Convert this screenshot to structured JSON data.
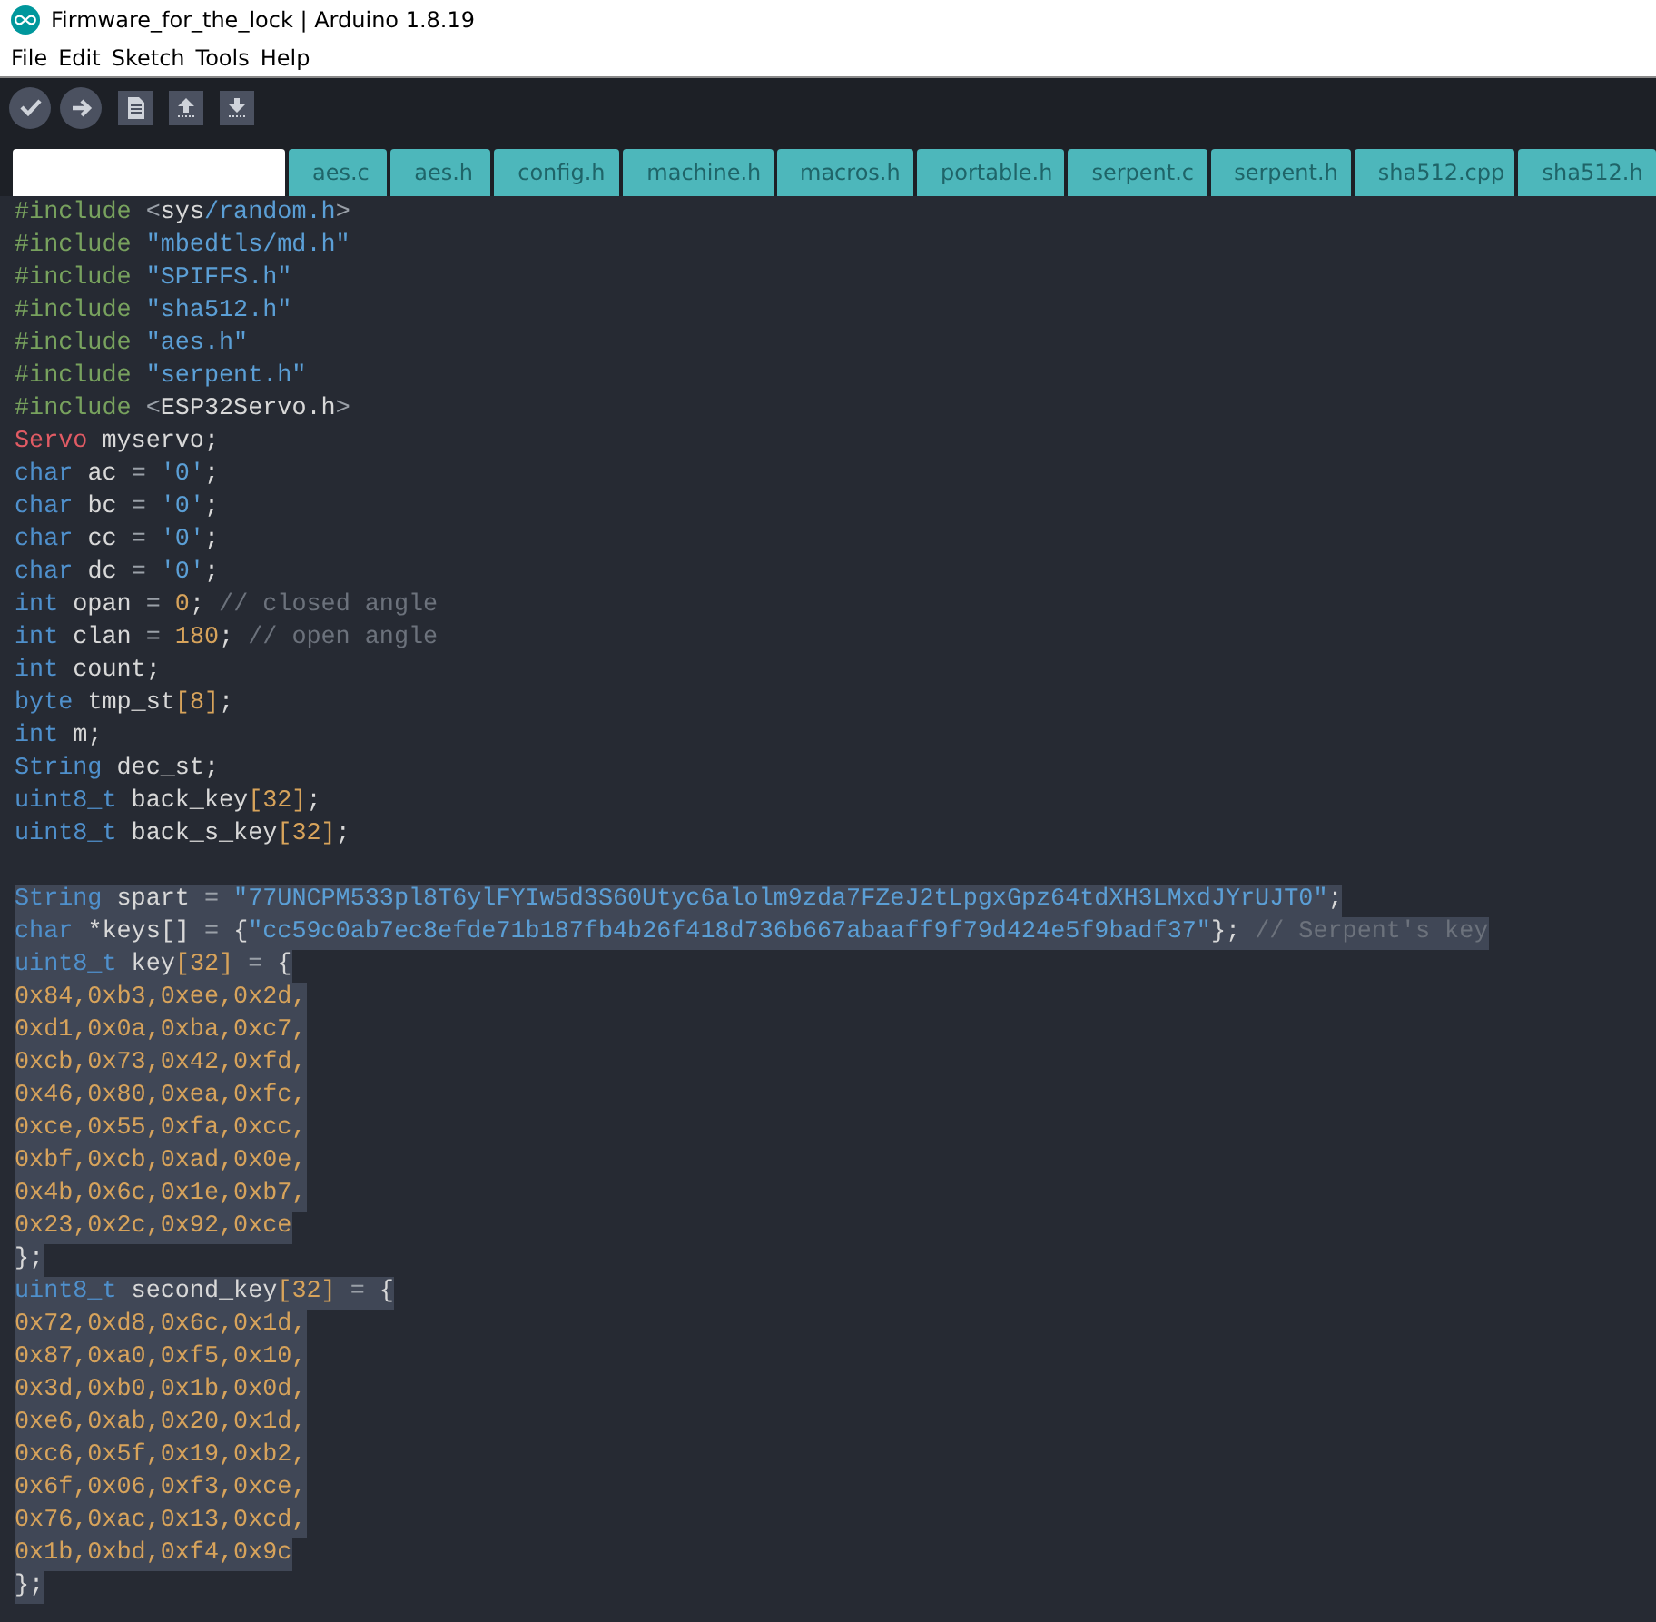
{
  "window": {
    "title": "Firmware_for_the_lock | Arduino 1.8.19"
  },
  "menu": [
    "File",
    "Edit",
    "Sketch",
    "Tools",
    "Help"
  ],
  "toolbar": [
    {
      "kind": "verify"
    },
    {
      "kind": "upload"
    },
    {
      "kind": "new"
    },
    {
      "kind": "open"
    },
    {
      "kind": "save"
    }
  ],
  "tabs": [
    {
      "selected": true
    },
    {
      "label": "aes.c",
      "selected": false
    },
    {
      "label": "aes.h",
      "selected": false
    },
    {
      "label": "config.h",
      "selected": false
    },
    {
      "label": "machine.h",
      "selected": false
    },
    {
      "label": "macros.h",
      "selected": false
    },
    {
      "label": "portable.h",
      "selected": false
    },
    {
      "label": "serpent.c",
      "selected": false
    },
    {
      "label": "serpent.h",
      "selected": false
    },
    {
      "label": "sha512.cpp",
      "selected": false
    },
    {
      "label": "sha512.h",
      "selected": false
    }
  ],
  "code": [
    {
      "selected": false,
      "tokens": [
        {
          "kind": "pre",
          "text": "#include "
        },
        {
          "kind": "punct",
          "text": "<"
        },
        {
          "kind": "plain",
          "text": "sys"
        },
        {
          "kind": "str",
          "text": "/random.h"
        },
        {
          "kind": "punct",
          "text": ">"
        }
      ]
    },
    {
      "selected": false,
      "tokens": [
        {
          "kind": "pre",
          "text": "#include "
        },
        {
          "kind": "str",
          "text": "\"mbedtls/md.h\""
        }
      ]
    },
    {
      "selected": false,
      "tokens": [
        {
          "kind": "pre",
          "text": "#include "
        },
        {
          "kind": "str",
          "text": "\"SPIFFS.h\""
        }
      ]
    },
    {
      "selected": false,
      "tokens": [
        {
          "kind": "pre",
          "text": "#include "
        },
        {
          "kind": "str",
          "text": "\"sha512.h\""
        }
      ]
    },
    {
      "selected": false,
      "tokens": [
        {
          "kind": "pre",
          "text": "#include "
        },
        {
          "kind": "str",
          "text": "\"aes.h\""
        }
      ]
    },
    {
      "selected": false,
      "tokens": [
        {
          "kind": "pre",
          "text": "#include "
        },
        {
          "kind": "str",
          "text": "\"serpent.h\""
        }
      ]
    },
    {
      "selected": false,
      "tokens": [
        {
          "kind": "pre",
          "text": "#include "
        },
        {
          "kind": "punct",
          "text": "<"
        },
        {
          "kind": "plain",
          "text": "ESP32Servo.h"
        },
        {
          "kind": "punct",
          "text": ">"
        }
      ]
    },
    {
      "selected": false,
      "tokens": [
        {
          "kind": "class",
          "text": "Servo"
        },
        {
          "kind": "plain",
          "text": " myservo;"
        }
      ]
    },
    {
      "selected": false,
      "tokens": [
        {
          "kind": "type",
          "text": "char"
        },
        {
          "kind": "plain",
          "text": " ac "
        },
        {
          "kind": "punct",
          "text": "= "
        },
        {
          "kind": "str",
          "text": "'0'"
        },
        {
          "kind": "plain",
          "text": ";"
        }
      ]
    },
    {
      "selected": false,
      "tokens": [
        {
          "kind": "type",
          "text": "char"
        },
        {
          "kind": "plain",
          "text": " bc "
        },
        {
          "kind": "punct",
          "text": "= "
        },
        {
          "kind": "str",
          "text": "'0'"
        },
        {
          "kind": "plain",
          "text": ";"
        }
      ]
    },
    {
      "selected": false,
      "tokens": [
        {
          "kind": "type",
          "text": "char"
        },
        {
          "kind": "plain",
          "text": " cc "
        },
        {
          "kind": "punct",
          "text": "= "
        },
        {
          "kind": "str",
          "text": "'0'"
        },
        {
          "kind": "plain",
          "text": ";"
        }
      ]
    },
    {
      "selected": false,
      "tokens": [
        {
          "kind": "type",
          "text": "char"
        },
        {
          "kind": "plain",
          "text": " dc "
        },
        {
          "kind": "punct",
          "text": "= "
        },
        {
          "kind": "str",
          "text": "'0'"
        },
        {
          "kind": "plain",
          "text": ";"
        }
      ]
    },
    {
      "selected": false,
      "tokens": [
        {
          "kind": "type",
          "text": "int"
        },
        {
          "kind": "plain",
          "text": " opan "
        },
        {
          "kind": "punct",
          "text": "= "
        },
        {
          "kind": "num",
          "text": "0"
        },
        {
          "kind": "plain",
          "text": "; "
        },
        {
          "kind": "comment",
          "text": "// closed angle"
        }
      ]
    },
    {
      "selected": false,
      "tokens": [
        {
          "kind": "type",
          "text": "int"
        },
        {
          "kind": "plain",
          "text": " clan "
        },
        {
          "kind": "punct",
          "text": "= "
        },
        {
          "kind": "num",
          "text": "180"
        },
        {
          "kind": "plain",
          "text": "; "
        },
        {
          "kind": "comment",
          "text": "// open angle"
        }
      ]
    },
    {
      "selected": false,
      "tokens": [
        {
          "kind": "type",
          "text": "int"
        },
        {
          "kind": "plain",
          "text": " count;"
        }
      ]
    },
    {
      "selected": false,
      "tokens": [
        {
          "kind": "type",
          "text": "byte"
        },
        {
          "kind": "plain",
          "text": " tmp_st"
        },
        {
          "kind": "num",
          "text": "[8]"
        },
        {
          "kind": "plain",
          "text": ";"
        }
      ]
    },
    {
      "selected": false,
      "tokens": [
        {
          "kind": "type",
          "text": "int"
        },
        {
          "kind": "plain",
          "text": " m;"
        }
      ]
    },
    {
      "selected": false,
      "tokens": [
        {
          "kind": "type",
          "text": "String"
        },
        {
          "kind": "plain",
          "text": " dec_st;"
        }
      ]
    },
    {
      "selected": false,
      "tokens": [
        {
          "kind": "type",
          "text": "uint8_t"
        },
        {
          "kind": "plain",
          "text": " back_key"
        },
        {
          "kind": "num",
          "text": "[32]"
        },
        {
          "kind": "plain",
          "text": ";"
        }
      ]
    },
    {
      "selected": false,
      "tokens": [
        {
          "kind": "type",
          "text": "uint8_t"
        },
        {
          "kind": "plain",
          "text": " back_s_key"
        },
        {
          "kind": "num",
          "text": "[32]"
        },
        {
          "kind": "plain",
          "text": ";"
        }
      ]
    },
    {
      "kind": "blank"
    },
    {
      "selected": true,
      "tokens": [
        {
          "kind": "type",
          "text": "String"
        },
        {
          "kind": "plain",
          "text": " spart "
        },
        {
          "kind": "punct",
          "text": "= "
        },
        {
          "kind": "str",
          "text": "\"77UNCPM533pl8T6ylFYIw5d3S60Utyc6alolm9zda7FZeJ2tLpgxGpz64tdXH3LMxdJYrUJT0\""
        },
        {
          "kind": "plain",
          "text": ";"
        }
      ]
    },
    {
      "selected": true,
      "tokens": [
        {
          "kind": "type",
          "text": "char"
        },
        {
          "kind": "plain",
          "text": " *keys[] "
        },
        {
          "kind": "punct",
          "text": "="
        },
        {
          "kind": "plain",
          "text": " {"
        },
        {
          "kind": "str",
          "text": "\"cc59c0ab7ec8efde71b187fb4b26f418d736b667abaaff9f79d424e5f9badf37\""
        },
        {
          "kind": "plain",
          "text": "}; "
        },
        {
          "kind": "comment",
          "text": "// Serpent's key"
        }
      ]
    },
    {
      "selected": true,
      "tokens": [
        {
          "kind": "type",
          "text": "uint8_t"
        },
        {
          "kind": "plain",
          "text": " key"
        },
        {
          "kind": "num",
          "text": "[32]"
        },
        {
          "kind": "punct",
          "text": " ="
        },
        {
          "kind": "plain",
          "text": " {"
        }
      ]
    },
    {
      "selected": true,
      "tokens": [
        {
          "kind": "num",
          "text": "0x84,0xb3,0xee,0x2d,"
        }
      ]
    },
    {
      "selected": true,
      "tokens": [
        {
          "kind": "num",
          "text": "0xd1,0x0a,0xba,0xc7,"
        }
      ]
    },
    {
      "selected": true,
      "tokens": [
        {
          "kind": "num",
          "text": "0xcb,0x73,0x42,0xfd,"
        }
      ]
    },
    {
      "selected": true,
      "tokens": [
        {
          "kind": "num",
          "text": "0x46,0x80,0xea,0xfc,"
        }
      ]
    },
    {
      "selected": true,
      "tokens": [
        {
          "kind": "num",
          "text": "0xce,0x55,0xfa,0xcc,"
        }
      ]
    },
    {
      "selected": true,
      "tokens": [
        {
          "kind": "num",
          "text": "0xbf,0xcb,0xad,0x0e,"
        }
      ]
    },
    {
      "selected": true,
      "tokens": [
        {
          "kind": "num",
          "text": "0x4b,0x6c,0x1e,0xb7,"
        }
      ]
    },
    {
      "selected": true,
      "tokens": [
        {
          "kind": "num",
          "text": "0x23,0x2c,0x92,0xce"
        }
      ]
    },
    {
      "selected": true,
      "tokens": [
        {
          "kind": "plain",
          "text": "};"
        }
      ]
    },
    {
      "selected": true,
      "tokens": [
        {
          "kind": "type",
          "text": "uint8_t"
        },
        {
          "kind": "plain",
          "text": " second_key"
        },
        {
          "kind": "num",
          "text": "[32]"
        },
        {
          "kind": "punct",
          "text": " ="
        },
        {
          "kind": "plain",
          "text": " {"
        }
      ]
    },
    {
      "selected": true,
      "tokens": [
        {
          "kind": "num",
          "text": "0x72,0xd8,0x6c,0x1d,"
        }
      ]
    },
    {
      "selected": true,
      "tokens": [
        {
          "kind": "num",
          "text": "0x87,0xa0,0xf5,0x10,"
        }
      ]
    },
    {
      "selected": true,
      "tokens": [
        {
          "kind": "num",
          "text": "0x3d,0xb0,0x1b,0x0d,"
        }
      ]
    },
    {
      "selected": true,
      "tokens": [
        {
          "kind": "num",
          "text": "0xe6,0xab,0x20,0x1d,"
        }
      ]
    },
    {
      "selected": true,
      "tokens": [
        {
          "kind": "num",
          "text": "0xc6,0x5f,0x19,0xb2,"
        }
      ]
    },
    {
      "selected": true,
      "tokens": [
        {
          "kind": "num",
          "text": "0x6f,0x06,0xf3,0xce,"
        }
      ]
    },
    {
      "selected": true,
      "tokens": [
        {
          "kind": "num",
          "text": "0x76,0xac,0x13,0xcd,"
        }
      ]
    },
    {
      "selected": true,
      "tokens": [
        {
          "kind": "num",
          "text": "0x1b,0xbd,0xf4,0x9c"
        }
      ]
    },
    {
      "selected": true,
      "tokens": [
        {
          "kind": "plain",
          "text": "};"
        }
      ]
    }
  ]
}
